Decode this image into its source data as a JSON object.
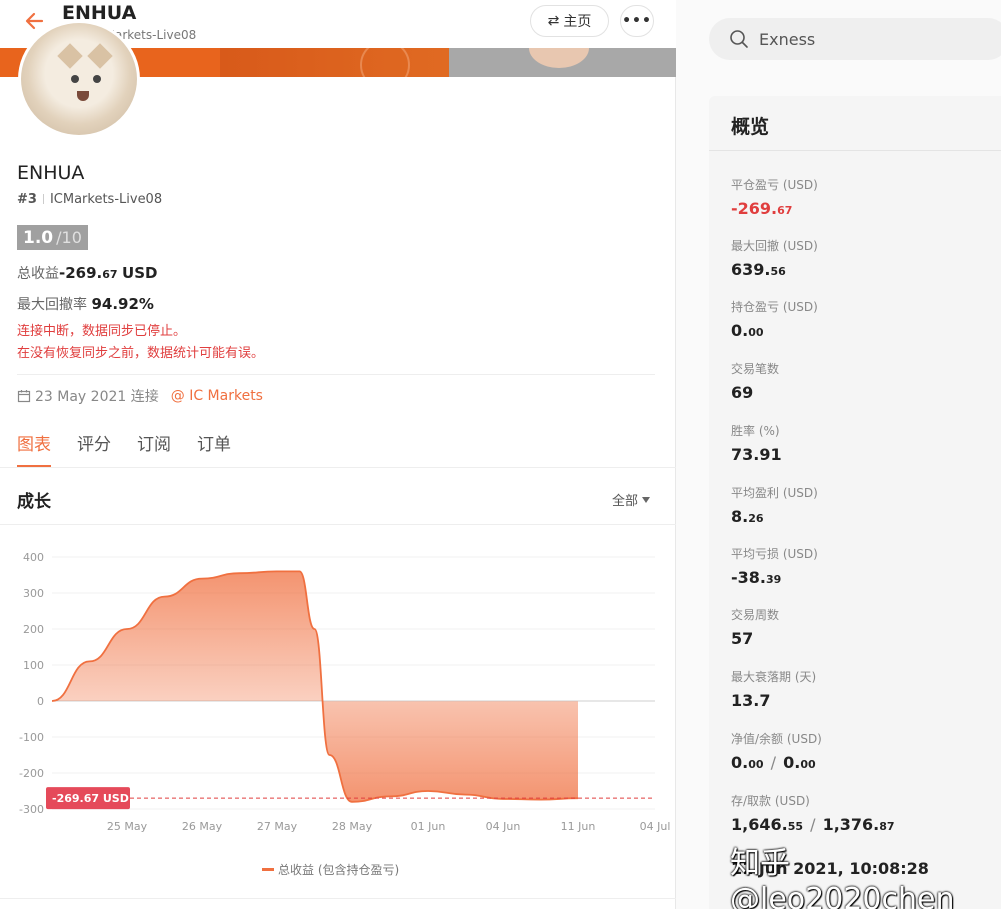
{
  "header": {
    "title": "ENHUA",
    "rank": "#3",
    "server": "ICMarkets-Live08",
    "home_label": "主页"
  },
  "profile": {
    "name": "ENHUA",
    "rank": "#3",
    "server": "ICMarkets-Live08",
    "score": "1.0",
    "score_max": "/10",
    "total_profit_label": "总收益",
    "total_profit_int": "-269.",
    "total_profit_dec": "67",
    "total_profit_unit": "USD",
    "max_drawdown_label": "最大回撤率",
    "max_drawdown_value": "94.92%",
    "warning_1": "连接中断，数据同步已停止。",
    "warning_2": "在没有恢复同步之前，数据统计可能有误。",
    "connect_date": "23 May 2021 连接",
    "broker": "@ IC Markets"
  },
  "tabs": [
    "图表",
    "评分",
    "订阅",
    "订单"
  ],
  "growth": {
    "title": "成长",
    "filter": "全部",
    "legend": "总收益 (包含持仓盈亏)",
    "current_label": "-269.67 USD"
  },
  "chart_data": {
    "type": "area",
    "x_ticks": [
      "25 May",
      "26 May",
      "27 May",
      "28 May",
      "01 Jun",
      "04 Jun",
      "11 Jun",
      "04 Jul"
    ],
    "y_ticks": [
      400,
      300,
      200,
      100,
      0,
      -100,
      -200,
      -300
    ],
    "ylim": [
      -300,
      400
    ],
    "series": [
      {
        "name": "总收益 (包含持仓盈亏)",
        "x": [
          0,
          0.5,
          1,
          1.5,
          2,
          2.5,
          3,
          3.3,
          3.5,
          3.7,
          4,
          4.5,
          5,
          5.5,
          6,
          6.5,
          7
        ],
        "values": [
          0,
          110,
          200,
          290,
          340,
          355,
          360,
          360,
          200,
          -150,
          -280,
          -265,
          -250,
          -260,
          -272,
          -274,
          -270
        ]
      }
    ],
    "reference_line": -269.67,
    "colors": {
      "line": "#f07040",
      "fill": "#f07040",
      "reference": "#e03e3e"
    }
  },
  "search": {
    "value": "Exness"
  },
  "overview": {
    "title": "概览",
    "stats": [
      {
        "label": "平仓盈亏 (USD)",
        "value": "-269.",
        "dec": "67"
      },
      {
        "label": "最大回撤 (USD)",
        "value": "639.",
        "dec": "56"
      },
      {
        "label": "持仓盈亏 (USD)",
        "value": "0.",
        "dec": "00"
      },
      {
        "label": "交易笔数",
        "value": "69",
        "dec": ""
      },
      {
        "label": "胜率 (%)",
        "value": "73.91",
        "dec": ""
      },
      {
        "label": "平均盈利 (USD)",
        "value": "8.",
        "dec": "26"
      },
      {
        "label": "平均亏损 (USD)",
        "value": "-38.",
        "dec": "39"
      },
      {
        "label": "交易周数",
        "value": "57",
        "dec": ""
      },
      {
        "label": "最大衰落期 (天)",
        "value": "13.7",
        "dec": ""
      },
      {
        "label": "净值/余额 (USD)",
        "value": "0.",
        "dec": "00",
        "value2": "0.",
        "dec2": "00"
      },
      {
        "label": "存/取款 (USD)",
        "value": "1,646.",
        "dec": "55",
        "value2": "1,376.",
        "dec2": "87"
      },
      {
        "label": "",
        "value": "11 Jun 2021, 10:08:28",
        "dec": ""
      }
    ]
  },
  "watermark": "知乎 @leo2020chen"
}
